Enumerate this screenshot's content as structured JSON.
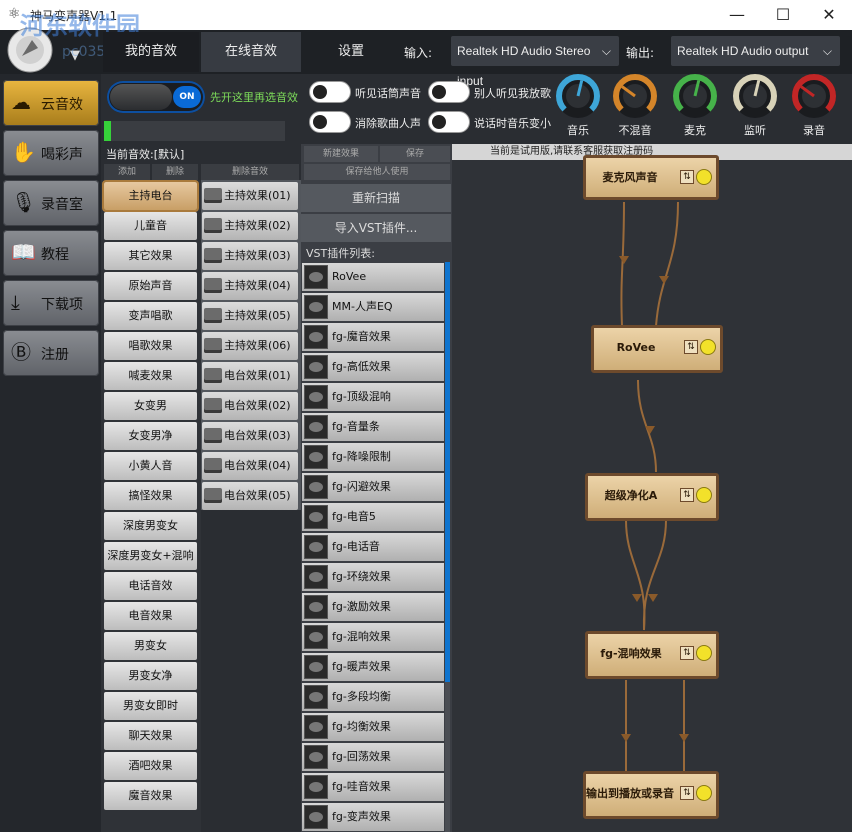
{
  "window": {
    "title": "神马变声器V1.1",
    "watermark": "河东软件园",
    "watermark_url": "pc0359",
    "minimize": "—",
    "maximize": "☐",
    "close": "✕"
  },
  "tabs": {
    "local": "我的音效",
    "online": "在线音效",
    "settings": "设置"
  },
  "io": {
    "input_label": "输入:",
    "input_value": "Realtek HD Audio Stereo input",
    "output_label": "输出:",
    "output_value": "Realtek HD Audio output"
  },
  "sidebar": {
    "items": [
      {
        "label": "云音效",
        "icon": "cloud-icon"
      },
      {
        "label": "喝彩声",
        "icon": "hands-icon"
      },
      {
        "label": "录音室",
        "icon": "microphone-icon"
      },
      {
        "label": "教程",
        "icon": "book-icon"
      },
      {
        "label": "下载项",
        "icon": "download-icon"
      },
      {
        "label": "注册",
        "icon": "register-icon"
      }
    ]
  },
  "toggle": {
    "state": "ON",
    "hint": "先开这里再选音效"
  },
  "meter": {
    "level": 0.04
  },
  "checks": [
    {
      "label": "听见话筒声音"
    },
    {
      "label": "别人听见我放歌"
    },
    {
      "label": "消除歌曲人声"
    },
    {
      "label": "说话时音乐变小"
    }
  ],
  "knobs": [
    {
      "label": "音乐",
      "color": "#3ea6d8",
      "level": 0.55
    },
    {
      "label": "不混音",
      "color": "#d4852a",
      "level": 0.3
    },
    {
      "label": "麦克",
      "color": "#46b24a",
      "level": 0.55
    },
    {
      "label": "监听",
      "color": "#d8d2b8",
      "level": 0.55
    },
    {
      "label": "录音",
      "color": "#c22626",
      "level": 0.3
    }
  ],
  "current": "当前音效:[默认]",
  "col_headers": {
    "add": "添加",
    "delete": "删除",
    "delete_effect": "删除音效",
    "new_effect": "新建效果",
    "save": "保存",
    "save_share": "保存给他人使用"
  },
  "effects": [
    "主持电台",
    "儿童音",
    "其它效果",
    "原始声音",
    "变声唱歌",
    "唱歌效果",
    "喊麦效果",
    "女变男",
    "女变男净",
    "小黄人音",
    "搞怪效果",
    "深度男变女",
    "深度男变女+混响",
    "电话音效",
    "电音效果",
    "男变女",
    "男变女净",
    "男变女即时",
    "聊天效果",
    "酒吧效果",
    "魔音效果"
  ],
  "presets": [
    "主持效果(01)",
    "主持效果(02)",
    "主持效果(03)",
    "主持效果(04)",
    "主持效果(05)",
    "主持效果(06)",
    "电台效果(01)",
    "电台效果(02)",
    "电台效果(03)",
    "电台效果(04)",
    "电台效果(05)"
  ],
  "tools": {
    "rescan": "重新扫描",
    "import_vst": "导入VST插件...",
    "vst_list_label": "VST插件列表:"
  },
  "vst": [
    "RoVee",
    "MM-人声EQ",
    "fg-魔音效果",
    "fg-高低效果",
    "fg-顶级混响",
    "fg-音量条",
    "fg-降噪限制",
    "fg-闪避效果",
    "fg-电音5",
    "fg-电话音",
    "fg-环绕效果",
    "fg-激励效果",
    "fg-混响效果",
    "fg-暖声效果",
    "fg-多段均衡",
    "fg-均衡效果",
    "fg-回荡效果",
    "fg-哇音效果",
    "fg-变声效果"
  ],
  "trial_notice": "当前是试用版,请联系客服获取注册码",
  "nodes": [
    {
      "label": "麦克风声音"
    },
    {
      "label": "RoVee"
    },
    {
      "label": "超级净化A"
    },
    {
      "label": "fg-混响效果"
    },
    {
      "label": "输出到播放或录音"
    }
  ]
}
